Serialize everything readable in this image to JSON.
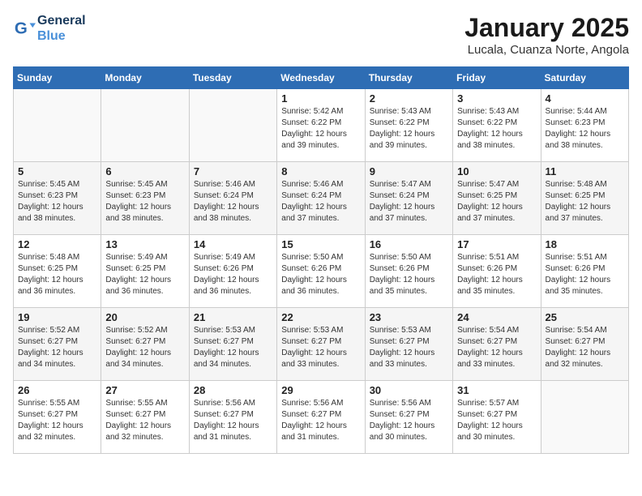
{
  "header": {
    "logo_line1": "General",
    "logo_line2": "Blue",
    "month": "January 2025",
    "location": "Lucala, Cuanza Norte, Angola"
  },
  "days_of_week": [
    "Sunday",
    "Monday",
    "Tuesday",
    "Wednesday",
    "Thursday",
    "Friday",
    "Saturday"
  ],
  "weeks": [
    [
      {
        "day": "",
        "info": ""
      },
      {
        "day": "",
        "info": ""
      },
      {
        "day": "",
        "info": ""
      },
      {
        "day": "1",
        "info": "Sunrise: 5:42 AM\nSunset: 6:22 PM\nDaylight: 12 hours\nand 39 minutes."
      },
      {
        "day": "2",
        "info": "Sunrise: 5:43 AM\nSunset: 6:22 PM\nDaylight: 12 hours\nand 39 minutes."
      },
      {
        "day": "3",
        "info": "Sunrise: 5:43 AM\nSunset: 6:22 PM\nDaylight: 12 hours\nand 38 minutes."
      },
      {
        "day": "4",
        "info": "Sunrise: 5:44 AM\nSunset: 6:23 PM\nDaylight: 12 hours\nand 38 minutes."
      }
    ],
    [
      {
        "day": "5",
        "info": "Sunrise: 5:45 AM\nSunset: 6:23 PM\nDaylight: 12 hours\nand 38 minutes."
      },
      {
        "day": "6",
        "info": "Sunrise: 5:45 AM\nSunset: 6:23 PM\nDaylight: 12 hours\nand 38 minutes."
      },
      {
        "day": "7",
        "info": "Sunrise: 5:46 AM\nSunset: 6:24 PM\nDaylight: 12 hours\nand 38 minutes."
      },
      {
        "day": "8",
        "info": "Sunrise: 5:46 AM\nSunset: 6:24 PM\nDaylight: 12 hours\nand 37 minutes."
      },
      {
        "day": "9",
        "info": "Sunrise: 5:47 AM\nSunset: 6:24 PM\nDaylight: 12 hours\nand 37 minutes."
      },
      {
        "day": "10",
        "info": "Sunrise: 5:47 AM\nSunset: 6:25 PM\nDaylight: 12 hours\nand 37 minutes."
      },
      {
        "day": "11",
        "info": "Sunrise: 5:48 AM\nSunset: 6:25 PM\nDaylight: 12 hours\nand 37 minutes."
      }
    ],
    [
      {
        "day": "12",
        "info": "Sunrise: 5:48 AM\nSunset: 6:25 PM\nDaylight: 12 hours\nand 36 minutes."
      },
      {
        "day": "13",
        "info": "Sunrise: 5:49 AM\nSunset: 6:25 PM\nDaylight: 12 hours\nand 36 minutes."
      },
      {
        "day": "14",
        "info": "Sunrise: 5:49 AM\nSunset: 6:26 PM\nDaylight: 12 hours\nand 36 minutes."
      },
      {
        "day": "15",
        "info": "Sunrise: 5:50 AM\nSunset: 6:26 PM\nDaylight: 12 hours\nand 36 minutes."
      },
      {
        "day": "16",
        "info": "Sunrise: 5:50 AM\nSunset: 6:26 PM\nDaylight: 12 hours\nand 35 minutes."
      },
      {
        "day": "17",
        "info": "Sunrise: 5:51 AM\nSunset: 6:26 PM\nDaylight: 12 hours\nand 35 minutes."
      },
      {
        "day": "18",
        "info": "Sunrise: 5:51 AM\nSunset: 6:26 PM\nDaylight: 12 hours\nand 35 minutes."
      }
    ],
    [
      {
        "day": "19",
        "info": "Sunrise: 5:52 AM\nSunset: 6:27 PM\nDaylight: 12 hours\nand 34 minutes."
      },
      {
        "day": "20",
        "info": "Sunrise: 5:52 AM\nSunset: 6:27 PM\nDaylight: 12 hours\nand 34 minutes."
      },
      {
        "day": "21",
        "info": "Sunrise: 5:53 AM\nSunset: 6:27 PM\nDaylight: 12 hours\nand 34 minutes."
      },
      {
        "day": "22",
        "info": "Sunrise: 5:53 AM\nSunset: 6:27 PM\nDaylight: 12 hours\nand 33 minutes."
      },
      {
        "day": "23",
        "info": "Sunrise: 5:53 AM\nSunset: 6:27 PM\nDaylight: 12 hours\nand 33 minutes."
      },
      {
        "day": "24",
        "info": "Sunrise: 5:54 AM\nSunset: 6:27 PM\nDaylight: 12 hours\nand 33 minutes."
      },
      {
        "day": "25",
        "info": "Sunrise: 5:54 AM\nSunset: 6:27 PM\nDaylight: 12 hours\nand 32 minutes."
      }
    ],
    [
      {
        "day": "26",
        "info": "Sunrise: 5:55 AM\nSunset: 6:27 PM\nDaylight: 12 hours\nand 32 minutes."
      },
      {
        "day": "27",
        "info": "Sunrise: 5:55 AM\nSunset: 6:27 PM\nDaylight: 12 hours\nand 32 minutes."
      },
      {
        "day": "28",
        "info": "Sunrise: 5:56 AM\nSunset: 6:27 PM\nDaylight: 12 hours\nand 31 minutes."
      },
      {
        "day": "29",
        "info": "Sunrise: 5:56 AM\nSunset: 6:27 PM\nDaylight: 12 hours\nand 31 minutes."
      },
      {
        "day": "30",
        "info": "Sunrise: 5:56 AM\nSunset: 6:27 PM\nDaylight: 12 hours\nand 30 minutes."
      },
      {
        "day": "31",
        "info": "Sunrise: 5:57 AM\nSunset: 6:27 PM\nDaylight: 12 hours\nand 30 minutes."
      },
      {
        "day": "",
        "info": ""
      }
    ]
  ]
}
